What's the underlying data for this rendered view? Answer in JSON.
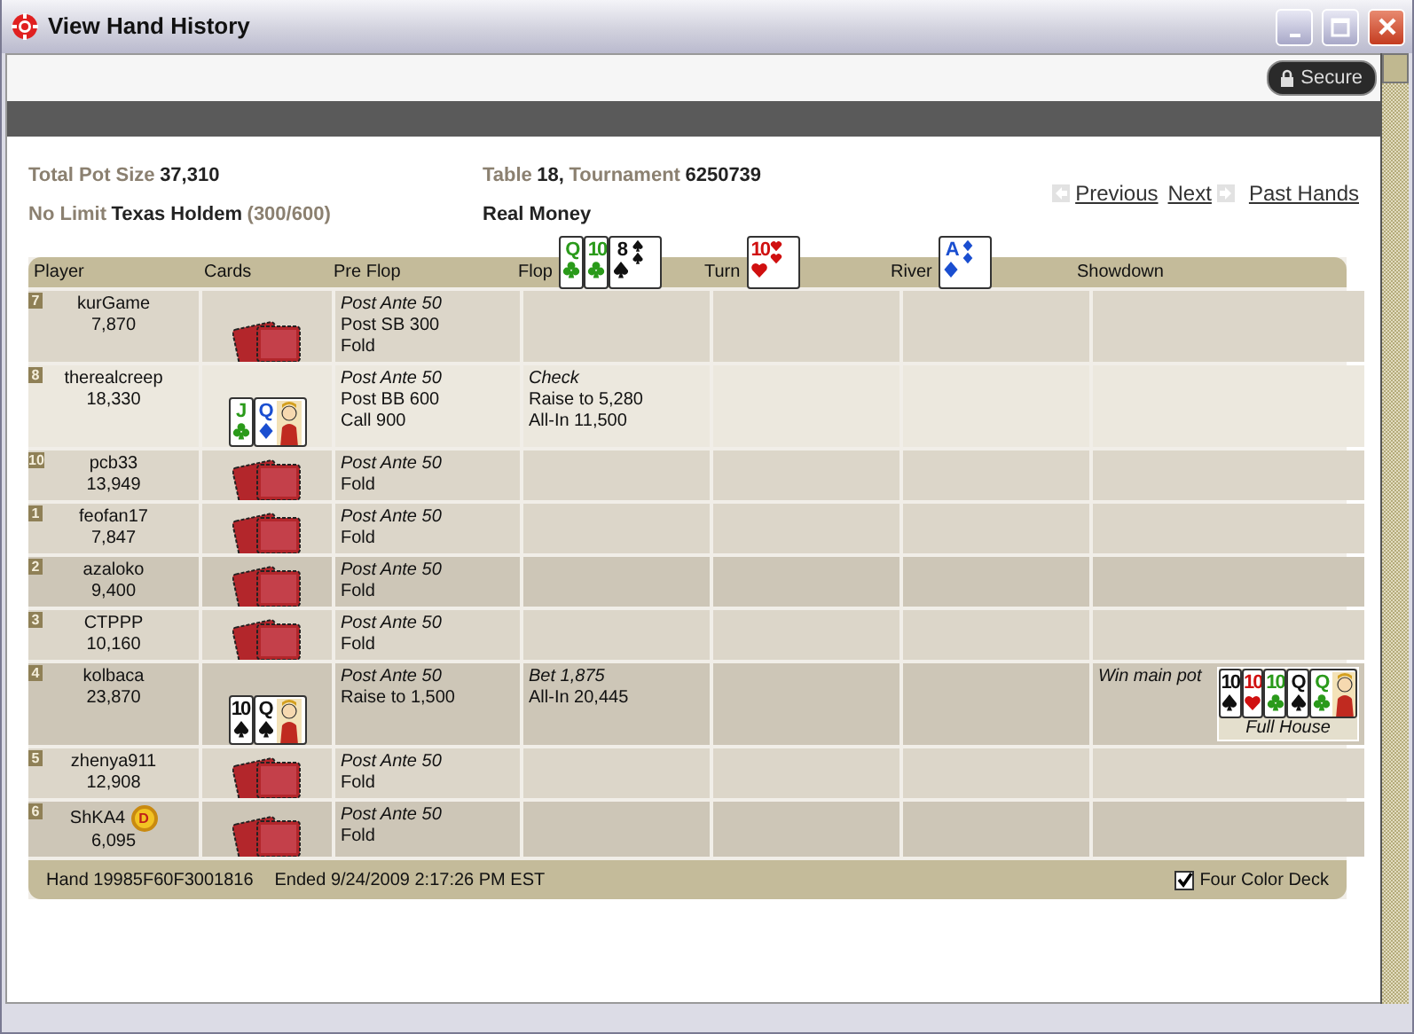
{
  "window": {
    "title": "View Hand History"
  },
  "secure_badge": "Secure",
  "summary": {
    "pot_label": "Total Pot Size",
    "pot": "37,310",
    "limit": "No Limit",
    "game": "Texas Holdem",
    "stakes": "(300/600)",
    "table_label": "Table",
    "table": "18,",
    "tournament_label": "Tournament",
    "tournament": "6250739",
    "money": "Real Money"
  },
  "nav": {
    "previous": "Previous",
    "next": "Next",
    "past": "Past Hands"
  },
  "columns": [
    {
      "label": "Player"
    },
    {
      "label": "Cards"
    },
    {
      "label": "Pre Flop"
    },
    {
      "label": "Flop",
      "cards": [
        {
          "rank": "Q",
          "kind": "clubs"
        },
        {
          "rank": "10",
          "kind": "clubs"
        },
        {
          "rank": "8",
          "kind": "spades",
          "court": false
        }
      ]
    },
    {
      "label": "Turn",
      "cards": [
        {
          "rank": "10",
          "kind": "hearts",
          "court": false
        }
      ]
    },
    {
      "label": "River",
      "cards": [
        {
          "rank": "A",
          "kind": "diamonds",
          "court": false
        }
      ]
    },
    {
      "label": "Showdown"
    }
  ],
  "rows": [
    {
      "seat": "7",
      "name": "kurGame",
      "chips": "7,870",
      "kind": "normal",
      "cards_shown": false,
      "streets": {
        "preflop": [
          {
            "text": "Post Ante 50",
            "italic": true
          },
          {
            "text": "Post SB 300",
            "italic": false
          },
          {
            "text": "Fold",
            "italic": false
          }
        ]
      }
    },
    {
      "seat": "8",
      "name": "therealcreep",
      "chips": "18,330",
      "kind": "light",
      "cards_shown": true,
      "hole_cards": [
        {
          "rank": "J",
          "kind": "clubs"
        },
        {
          "rank": "Q",
          "kind": "diamonds",
          "court": true
        }
      ],
      "streets": {
        "preflop": [
          {
            "text": "Post Ante 50",
            "italic": true
          },
          {
            "text": "Post BB 600",
            "italic": false
          },
          {
            "text": "Call 900",
            "italic": false
          }
        ],
        "flop": [
          {
            "text": "Check",
            "italic": true
          },
          {
            "text": "Raise to 5,280",
            "italic": false
          },
          {
            "text": "All-In 11,500",
            "italic": false
          }
        ]
      }
    },
    {
      "seat": "10",
      "name": "pcb33",
      "chips": "13,949",
      "kind": "normal",
      "cards_shown": false,
      "streets": {
        "preflop": [
          {
            "text": "Post Ante 50",
            "italic": true
          },
          {
            "text": "Fold",
            "italic": false
          }
        ]
      }
    },
    {
      "seat": "1",
      "name": "feofan17",
      "chips": "7,847",
      "kind": "normal",
      "cards_shown": false,
      "streets": {
        "preflop": [
          {
            "text": "Post Ante 50",
            "italic": true
          },
          {
            "text": "Fold",
            "italic": false
          }
        ]
      }
    },
    {
      "seat": "2",
      "name": "azaloko",
      "chips": "9,400",
      "kind": "dark",
      "cards_shown": false,
      "streets": {
        "preflop": [
          {
            "text": "Post Ante 50",
            "italic": true
          },
          {
            "text": "Fold",
            "italic": false
          }
        ]
      }
    },
    {
      "seat": "3",
      "name": "CTPPP",
      "chips": "10,160",
      "kind": "normal",
      "cards_shown": false,
      "streets": {
        "preflop": [
          {
            "text": "Post Ante 50",
            "italic": true
          },
          {
            "text": "Fold",
            "italic": false
          }
        ]
      }
    },
    {
      "seat": "4",
      "name": "kolbaca",
      "chips": "23,870",
      "kind": "dark",
      "cards_shown": true,
      "hole_cards": [
        {
          "rank": "10",
          "kind": "spades"
        },
        {
          "rank": "Q",
          "kind": "spades",
          "court": true
        }
      ],
      "streets": {
        "preflop": [
          {
            "text": "Post Ante 50",
            "italic": true
          },
          {
            "text": "Raise to 1,500",
            "italic": false
          }
        ],
        "flop": [
          {
            "text": "Bet 1,875",
            "italic": true
          },
          {
            "text": "All-In 20,445",
            "italic": false
          }
        ]
      },
      "showdown": {
        "result": "Win main pot",
        "hand_cards": [
          {
            "rank": "10",
            "kind": "spades"
          },
          {
            "rank": "10",
            "kind": "hearts"
          },
          {
            "rank": "10",
            "kind": "clubs"
          },
          {
            "rank": "Q",
            "kind": "spades"
          },
          {
            "rank": "Q",
            "kind": "clubs",
            "court": true
          }
        ],
        "hand_name": "Full House"
      }
    },
    {
      "seat": "5",
      "name": "zhenya911",
      "chips": "12,908",
      "kind": "normal",
      "cards_shown": false,
      "streets": {
        "preflop": [
          {
            "text": "Post Ante 50",
            "italic": true
          },
          {
            "text": "Fold",
            "italic": false
          }
        ]
      }
    },
    {
      "seat": "6",
      "name": "ShKA4",
      "chips": "6,095",
      "kind": "dark",
      "dealer": "D",
      "cards_shown": false,
      "streets": {
        "preflop": [
          {
            "text": "Post Ante 50",
            "italic": true
          },
          {
            "text": "Fold",
            "italic": false
          }
        ]
      }
    }
  ],
  "footer": {
    "hand": "Hand 19985F60F3001816",
    "ended": "Ended 9/24/2009 2:17:26 PM EST",
    "four_color": {
      "label": "Four Color Deck",
      "checked": true
    }
  }
}
